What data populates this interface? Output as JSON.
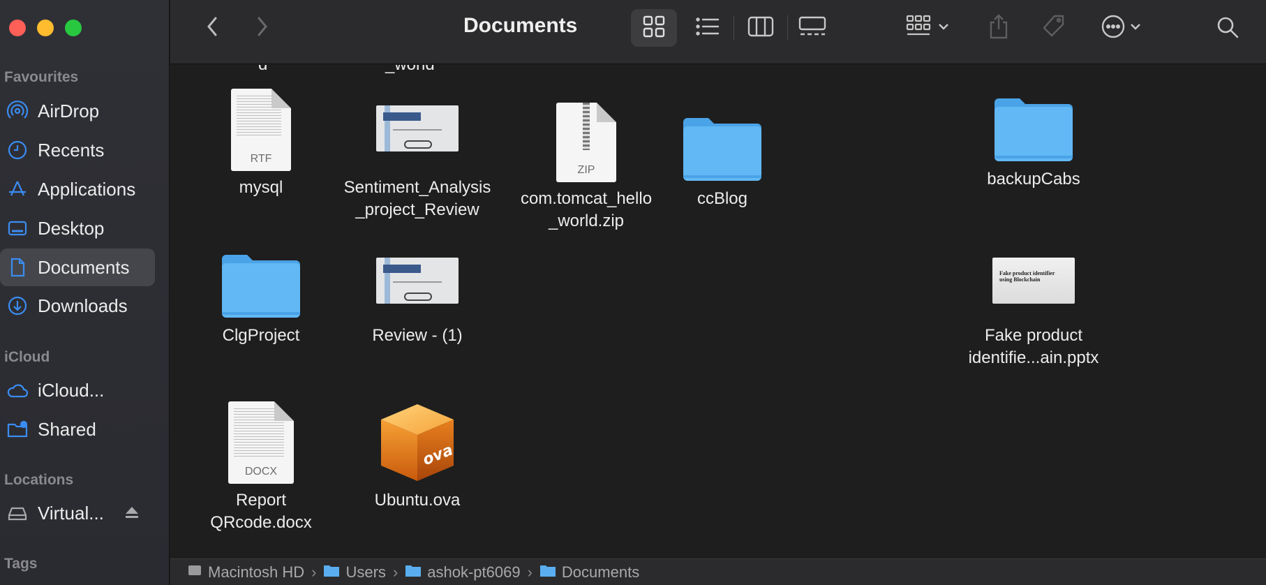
{
  "window": {
    "title": "Documents"
  },
  "sidebar": {
    "sections": [
      {
        "label": "Favourites"
      },
      {
        "label": "iCloud"
      },
      {
        "label": "Locations"
      },
      {
        "label": "Tags"
      }
    ],
    "items": [
      {
        "label": "AirDrop",
        "icon": "airdrop-icon"
      },
      {
        "label": "Recents",
        "icon": "clock-icon"
      },
      {
        "label": "Applications",
        "icon": "applications-icon"
      },
      {
        "label": "Desktop",
        "icon": "desktop-icon"
      },
      {
        "label": "Documents",
        "icon": "document-icon",
        "selected": true
      },
      {
        "label": "Downloads",
        "icon": "download-icon"
      },
      {
        "label": "iCloud...",
        "icon": "cloud-icon"
      },
      {
        "label": "Shared",
        "icon": "shared-folder-icon"
      },
      {
        "label": "Virtual...",
        "icon": "drive-icon"
      }
    ]
  },
  "toolbar": {
    "accent": "#3b8df2"
  },
  "files": {
    "cutoff": [
      "d",
      "_world"
    ],
    "items": [
      {
        "name": "mysql",
        "type": "rtf",
        "ext": "RTF"
      },
      {
        "name": "Sentiment_Analysis_project_Review",
        "type": "slide"
      },
      {
        "name": "com.tomcat_hello_world.zip",
        "type": "zip",
        "ext": "ZIP"
      },
      {
        "name": "ccBlog",
        "type": "folder"
      },
      {
        "name": "backupCabs",
        "type": "folder"
      },
      {
        "name": "ClgProject",
        "type": "folder"
      },
      {
        "name": "Review - (1)",
        "type": "slide"
      },
      {
        "name": "Fake product identifie...ain.pptx",
        "type": "slide",
        "slide_text": "Fake product identifier using Blockchain"
      },
      {
        "name": "Report QRcode.docx",
        "type": "docx",
        "ext": "DOCX"
      },
      {
        "name": "Ubuntu.ova",
        "type": "ova",
        "ext": "ova"
      }
    ]
  },
  "pathbar": {
    "crumbs": [
      "Macintosh HD",
      "Users",
      "ashok-pt6069",
      "Documents"
    ]
  },
  "colors": {
    "folder": "#62b8f5",
    "folder_dark": "#4aa3e6"
  }
}
